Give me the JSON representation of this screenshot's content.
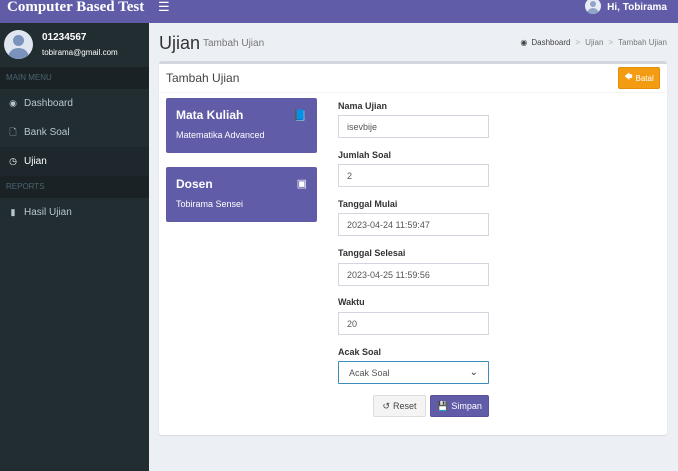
{
  "app": {
    "title": "Computer Based Test"
  },
  "navbar": {
    "menu_icon": "hamburger-icon",
    "greeting": "Hi, Tobirama"
  },
  "sidebar": {
    "user": {
      "id": "01234567",
      "email": "tobirama@gmail.com"
    },
    "sections": [
      {
        "header": "MAIN MENU"
      },
      {
        "header": "REPORTS"
      }
    ],
    "items": [
      {
        "label": "Dashboard",
        "icon": "dashboard-icon"
      },
      {
        "label": "Bank Soal",
        "icon": "file-icon"
      },
      {
        "label": "Ujian",
        "icon": "clock-icon",
        "active": true
      },
      {
        "label": "Hasil Ujian",
        "icon": "document-icon"
      }
    ]
  },
  "page": {
    "title": "Ujian",
    "subtitle": "Tambah Ujian",
    "breadcrumb": [
      "Dashboard",
      "Ujian",
      "Tambah Ujian"
    ]
  },
  "box": {
    "title": "Tambah Ujian",
    "back_label": "Batal"
  },
  "cards": [
    {
      "title": "Mata Kuliah",
      "value": "Matematika Advanced",
      "icon": "book-icon"
    },
    {
      "title": "Dosen",
      "value": "Tobirama Sensei",
      "icon": "contact-icon"
    }
  ],
  "form": {
    "nama_ujian": {
      "label": "Nama Ujian",
      "value": "isevbije"
    },
    "jumlah_soal": {
      "label": "Jumlah Soal",
      "value": "2"
    },
    "tanggal_mulai": {
      "label": "Tanggal Mulai",
      "value": "2023-04-24 11:59:47"
    },
    "tanggal_selesai": {
      "label": "Tanggal Selesai",
      "value": "2023-04-25 11:59:56"
    },
    "waktu": {
      "label": "Waktu",
      "value": "20"
    },
    "acak_soal": {
      "label": "Acak Soal",
      "value": "Acak Soal"
    },
    "reset_label": "Reset",
    "save_label": "Simpan"
  },
  "colors": {
    "primary": "#605ca8",
    "sidebar": "#222d32",
    "warning": "#f39c12",
    "focus": "#3c8dbc"
  }
}
